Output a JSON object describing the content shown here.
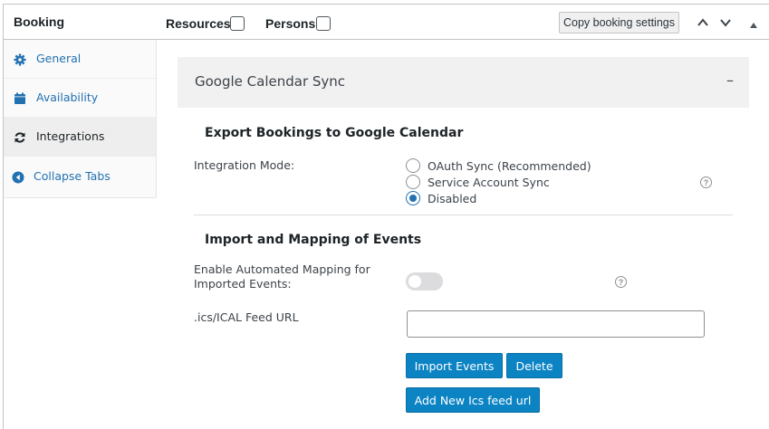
{
  "header": {
    "title": "Booking",
    "resources_label": "Resources:",
    "persons_label": "Persons:",
    "copy_button": "Copy booking settings",
    "icons": [
      "chevron-up-icon",
      "chevron-down-icon",
      "triangle-up-icon"
    ]
  },
  "sidebar": {
    "items": [
      {
        "label": "General",
        "icon": "gear-icon",
        "active": false
      },
      {
        "label": "Availability",
        "icon": "calendar-icon",
        "active": false
      },
      {
        "label": "Integrations",
        "icon": "sync-icon",
        "active": true
      },
      {
        "label": "Collapse Tabs",
        "icon": "collapse-arrow-icon",
        "active": false
      }
    ]
  },
  "main": {
    "section_title": "Google Calendar Sync",
    "section_toggle": "–",
    "export": {
      "heading": "Export Bookings to Google Calendar",
      "mode_label": "Integration Mode:",
      "options": [
        {
          "label": "OAuth Sync (Recommended)",
          "checked": false
        },
        {
          "label": "Service Account Sync",
          "checked": false
        },
        {
          "label": "Disabled",
          "checked": true
        }
      ],
      "help": "?"
    },
    "import": {
      "heading": "Import and Mapping of Events",
      "mapping_label_1": "Enable Automated Mapping for",
      "mapping_label_2": "Imported Events:",
      "mapping_enabled": false,
      "help": "?",
      "feed_label": ".ics/ICAL Feed URL",
      "feed_value": "",
      "import_button": "Import Events",
      "delete_button": "Delete",
      "add_button": "Add New Ics feed url"
    }
  },
  "colors": {
    "accent": "#2271b1",
    "button": "#0c84c4",
    "section_bg": "#f1f1f1"
  }
}
